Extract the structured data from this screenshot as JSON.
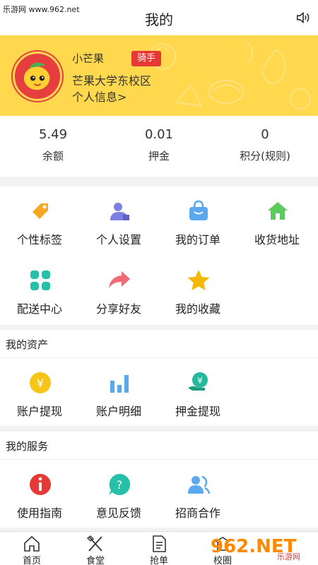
{
  "watermark": {
    "site": "乐游网 www.962.net",
    "logo_text": "962.NET",
    "logo_sub": "乐游网"
  },
  "header": {
    "title": "我的",
    "sound_icon": "speaker-icon"
  },
  "profile": {
    "name": "小芒果",
    "role_badge": "骑手",
    "school": "芒果大学东校区",
    "info_link": "个人信息>",
    "bg_color": "#ffd84d",
    "badge_color": "#e53935"
  },
  "stats": [
    {
      "value": "5.49",
      "label": "余额"
    },
    {
      "value": "0.01",
      "label": "押金"
    },
    {
      "value": "0",
      "label": "积分(规则)"
    }
  ],
  "menu": [
    {
      "label": "个性标签",
      "icon": "tag-icon",
      "color": "#f5a623"
    },
    {
      "label": "个人设置",
      "icon": "user-settings-icon",
      "color": "#7b7fe0"
    },
    {
      "label": "我的订单",
      "icon": "shopping-bag-icon",
      "color": "#5aa9ef"
    },
    {
      "label": "收货地址",
      "icon": "home-icon",
      "color": "#5cc95c"
    },
    {
      "label": "配送中心",
      "icon": "delivery-center-icon",
      "color": "#26c0a8"
    },
    {
      "label": "分享好友",
      "icon": "share-arrow-icon",
      "color": "#f06a75"
    },
    {
      "label": "我的收藏",
      "icon": "star-icon",
      "color": "#f5b800"
    }
  ],
  "assets": {
    "title": "我的资产",
    "items": [
      {
        "label": "账户提现",
        "icon": "yuan-coin-icon",
        "color": "#f5c518"
      },
      {
        "label": "账户明细",
        "icon": "bar-chart-icon",
        "color": "#5aa9ef"
      },
      {
        "label": "押金提现",
        "icon": "deposit-hand-icon",
        "color": "#26b89a"
      }
    ]
  },
  "services": {
    "title": "我的服务",
    "items": [
      {
        "label": "使用指南",
        "icon": "info-icon",
        "color": "#e53935"
      },
      {
        "label": "意见反馈",
        "icon": "feedback-icon",
        "color": "#26c0a8"
      },
      {
        "label": "招商合作",
        "icon": "partner-icon",
        "color": "#5aa9ef"
      }
    ]
  },
  "tabbar": [
    {
      "label": "首页",
      "icon": "home-outline-icon"
    },
    {
      "label": "食堂",
      "icon": "fork-knife-icon"
    },
    {
      "label": "抢单",
      "icon": "order-doc-icon"
    },
    {
      "label": "校圈",
      "icon": "campus-icon"
    }
  ]
}
